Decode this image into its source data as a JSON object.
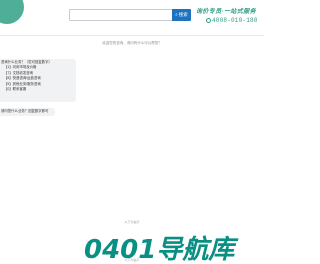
{
  "header": {
    "search": {
      "placeholder": "",
      "button_label": "搜索",
      "button_icon": "search-icon"
    },
    "slogan": "询价专员·一站式服务",
    "phone": "4008-010-180",
    "accent_color": "#2b9d86",
    "button_color": "#1e73be"
  },
  "chat": {
    "notice": "欢迎您的咨询，请问有什么可以帮您？",
    "menu": {
      "title": "咨询什么业务？（您可回复数字）",
      "options": [
        "【1】问询市场及价格",
        "【7】文档收发咨询",
        "【8】快递咨询/运费咨询",
        "【9】其他业务/服务咨询",
        "【0】联系客服"
      ]
    },
    "prompt": "请问您什么业务？回复数字即可"
  },
  "footer": {
    "note": "以下为提示",
    "brand": "0401导航库",
    "caption": "以下为提示"
  }
}
